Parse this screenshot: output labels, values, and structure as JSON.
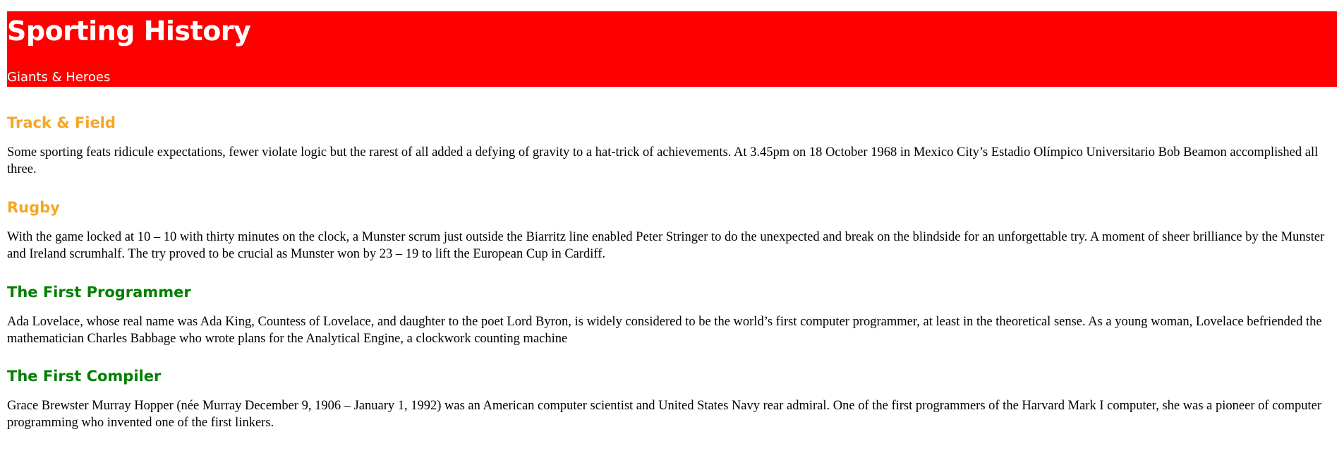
{
  "header": {
    "title": "Sporting History",
    "tagline": "Giants & Heroes"
  },
  "sections": [
    {
      "title": "Track & Field",
      "color": "#f5a623",
      "body": "Some sporting feats ridicule expectations, fewer violate logic but the rarest of all added a defying of gravity to a hat-trick of achievements. At 3.45pm on 18 October 1968 in Mexico City’s Estadio Olímpico Universitario Bob Beamon accomplished all three."
    },
    {
      "title": "Rugby",
      "color": "#f5a623",
      "body": "With the game locked at 10 – 10 with thirty minutes on the clock, a Munster scrum just outside the Biarritz line enabled Peter Stringer to do the unexpected and break on the blindside for an unforgettable try. A moment of sheer brilliance by the Munster and Ireland scrumhalf. The try proved to be crucial as Munster won by 23 – 19 to lift the European Cup in Cardiff."
    },
    {
      "title": "The First Programmer",
      "color": "#008000",
      "body": "Ada Lovelace, whose real name was Ada King, Countess of Lovelace, and daughter to the poet Lord Byron, is widely considered to be the world’s first computer programmer, at least in the theoretical sense. As a young woman, Lovelace befriended the mathematician Charles Babbage who wrote plans for the Analytical Engine, a clockwork counting machine"
    },
    {
      "title": "The First Compiler",
      "color": "#008000",
      "body": "Grace Brewster Murray Hopper (née Murray December 9, 1906 – January 1, 1992) was an American computer scientist and United States Navy rear admiral. One of the first programmers of the Harvard Mark I computer, she was a pioneer of computer programming who invented one of the first linkers."
    }
  ]
}
